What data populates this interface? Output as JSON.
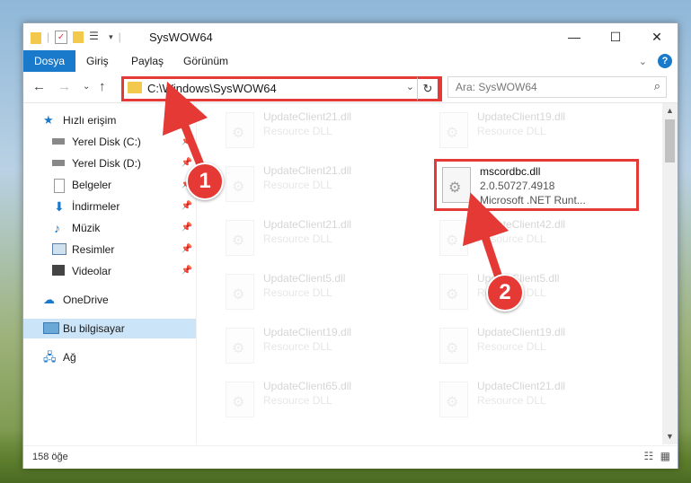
{
  "window": {
    "title": "SysWOW64",
    "controls": {
      "minimize": "—",
      "maximize": "☐",
      "close": "✕"
    }
  },
  "ribbon": {
    "tabs": [
      "Dosya",
      "Giriş",
      "Paylaş",
      "Görünüm"
    ],
    "help": "?"
  },
  "nav": {
    "address": "C:\\Windows\\SysWOW64",
    "search_placeholder": "Ara: SysWOW64"
  },
  "sidebar": {
    "items": [
      {
        "label": "Hızlı erişim",
        "icon": "star-icon"
      },
      {
        "label": "Yerel Disk (C:)",
        "icon": "drive-icon",
        "pinned": true
      },
      {
        "label": "Yerel Disk (D:)",
        "icon": "drive-icon",
        "pinned": true
      },
      {
        "label": "Belgeler",
        "icon": "documents-icon",
        "pinned": true
      },
      {
        "label": "İndirmeler",
        "icon": "download-icon",
        "pinned": true
      },
      {
        "label": "Müzik",
        "icon": "music-icon",
        "pinned": true
      },
      {
        "label": "Resimler",
        "icon": "pictures-icon",
        "pinned": true
      },
      {
        "label": "Videolar",
        "icon": "video-icon",
        "pinned": true
      },
      {
        "label": "OneDrive",
        "icon": "cloud-icon"
      },
      {
        "label": "Bu bilgisayar",
        "icon": "computer-icon"
      },
      {
        "label": "Ağ",
        "icon": "network-icon"
      }
    ]
  },
  "files": {
    "left": [
      {
        "name": "UpdateClient21.dll",
        "desc": "Resource DLL"
      },
      {
        "name": "UpdateClient21.dll",
        "desc": "Resource DLL"
      },
      {
        "name": "UpdateClient21.dll",
        "desc": "Resource DLL"
      },
      {
        "name": "UpdateClient5.dll",
        "desc": "Resource DLL"
      },
      {
        "name": "UpdateClient19.dll",
        "desc": "Resource DLL"
      },
      {
        "name": "UpdateClient65.dll",
        "desc": "Resource DLL"
      }
    ],
    "right": [
      {
        "name": "UpdateClient19.dll",
        "desc": "Resource DLL"
      },
      {
        "name": "UpdateClient42.dll",
        "desc": "Resource DLL"
      },
      {
        "name": "UpdateClient5.dll",
        "desc": "Resource DLL"
      },
      {
        "name": "UpdateClient19.dll",
        "desc": "Resource DLL"
      },
      {
        "name": "UpdateClient21.dll",
        "desc": "Resource DLL"
      }
    ],
    "highlighted": {
      "name": "mscordbc.dll",
      "version": "2.0.50727.4918",
      "company": "Microsoft .NET Runt..."
    }
  },
  "status": {
    "count": "158 öğe"
  },
  "callouts": {
    "one": "1",
    "two": "2"
  },
  "colors": {
    "accent": "#1979ca",
    "annotation": "#e53935"
  }
}
